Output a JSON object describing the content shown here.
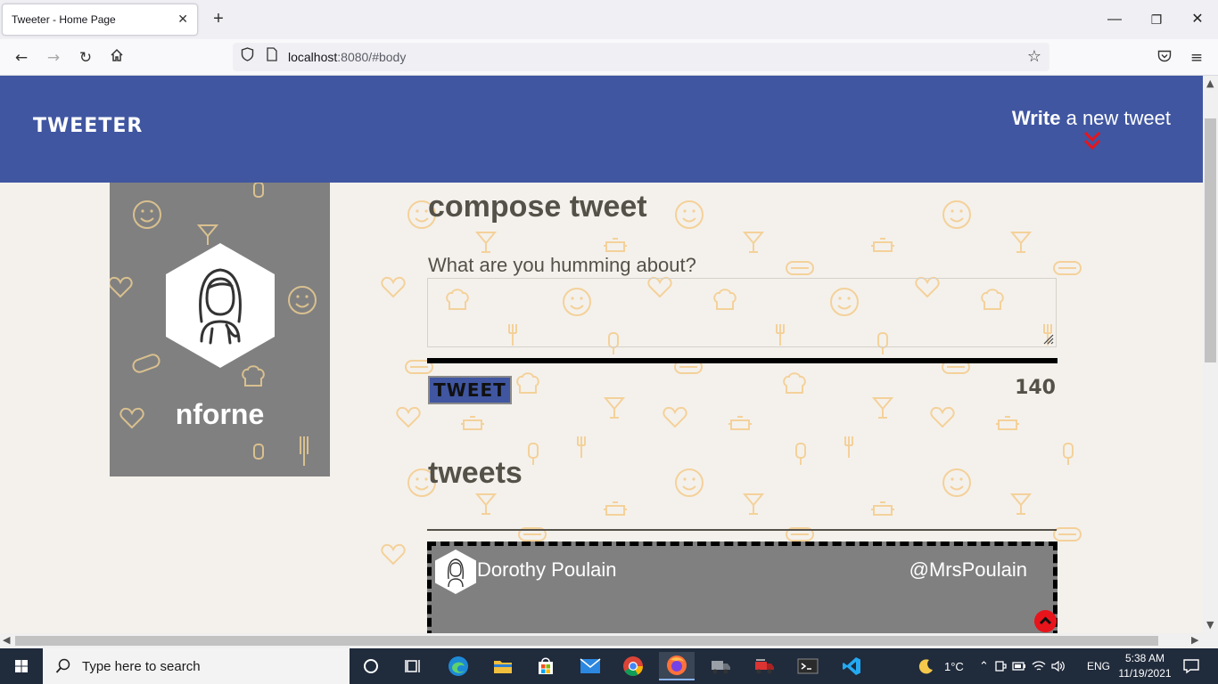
{
  "browser": {
    "tab_title": "Tweeter - Home Page",
    "tab_close": "✕",
    "new_tab": "+",
    "url_host": "localhost",
    "url_rest": ":8080/#body",
    "window_controls": [
      "—",
      "❐",
      "✕"
    ]
  },
  "site": {
    "brand": "TWEETER",
    "write_bold": "Write",
    "write_rest": " a new tweet",
    "accent_color": "#4056a1",
    "chevron_color": "#e8141c"
  },
  "profile": {
    "handle": "nforne"
  },
  "compose": {
    "heading": "compose tweet",
    "prompt": "What are you humming about?",
    "button_label": "TWEET",
    "counter": "140"
  },
  "tweets": {
    "heading": "tweets",
    "items": [
      {
        "name": "Dorothy Poulain",
        "handle": "@MrsPoulain"
      }
    ]
  },
  "taskbar": {
    "search_placeholder": "Type here to search",
    "weather": "1°C",
    "language": "ENG",
    "time": "5:38 AM",
    "date": "11/19/2021"
  }
}
